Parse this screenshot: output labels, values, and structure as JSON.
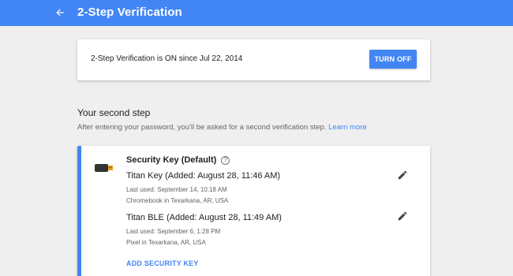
{
  "header": {
    "title": "2-Step Verification",
    "back_icon": "arrow-left-icon",
    "color": "#4285f4"
  },
  "status": {
    "text": "2-Step Verification is ON since Jul 22, 2014",
    "button": "TURN OFF"
  },
  "second_step": {
    "title": "Your second step",
    "description": "After entering your password, you'll be asked for a second verification step.",
    "learn_more": "Learn more"
  },
  "security_key": {
    "heading": "Security Key (Default)",
    "help_glyph": "?",
    "keys": [
      {
        "name": "Titan Key (Added: August 28, 11:46 AM)",
        "last_used": "Last used: September 14, 10:18 AM",
        "location": "Chromebook in Texarkana, AR, USA"
      },
      {
        "name": "Titan BLE (Added: August 28, 11:49 AM)",
        "last_used": "Last used: September 6, 1:28 PM",
        "location": "Pixel in Texarkana, AR, USA"
      }
    ],
    "add_label": "ADD SECURITY KEY"
  }
}
